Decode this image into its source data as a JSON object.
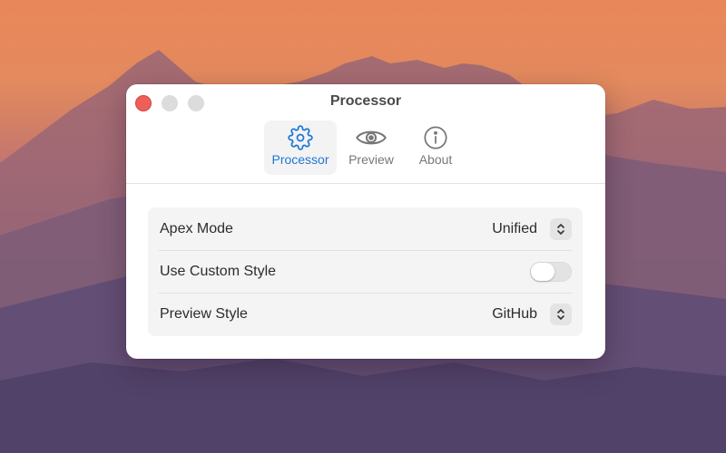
{
  "window": {
    "title": "Processor"
  },
  "tabs": [
    {
      "label": "Processor",
      "icon": "gear-icon",
      "active": true
    },
    {
      "label": "Preview",
      "icon": "eye-icon",
      "active": false
    },
    {
      "label": "About",
      "icon": "info-icon",
      "active": false
    }
  ],
  "settings": [
    {
      "label": "Apex Mode",
      "value": "Unified",
      "control": "popup"
    },
    {
      "label": "Use Custom Style",
      "enabled": false,
      "control": "toggle"
    },
    {
      "label": "Preview Style",
      "value": "GitHub",
      "control": "popup"
    }
  ],
  "colors": {
    "accent": "#1f77d4",
    "close": "#ed5f57"
  }
}
